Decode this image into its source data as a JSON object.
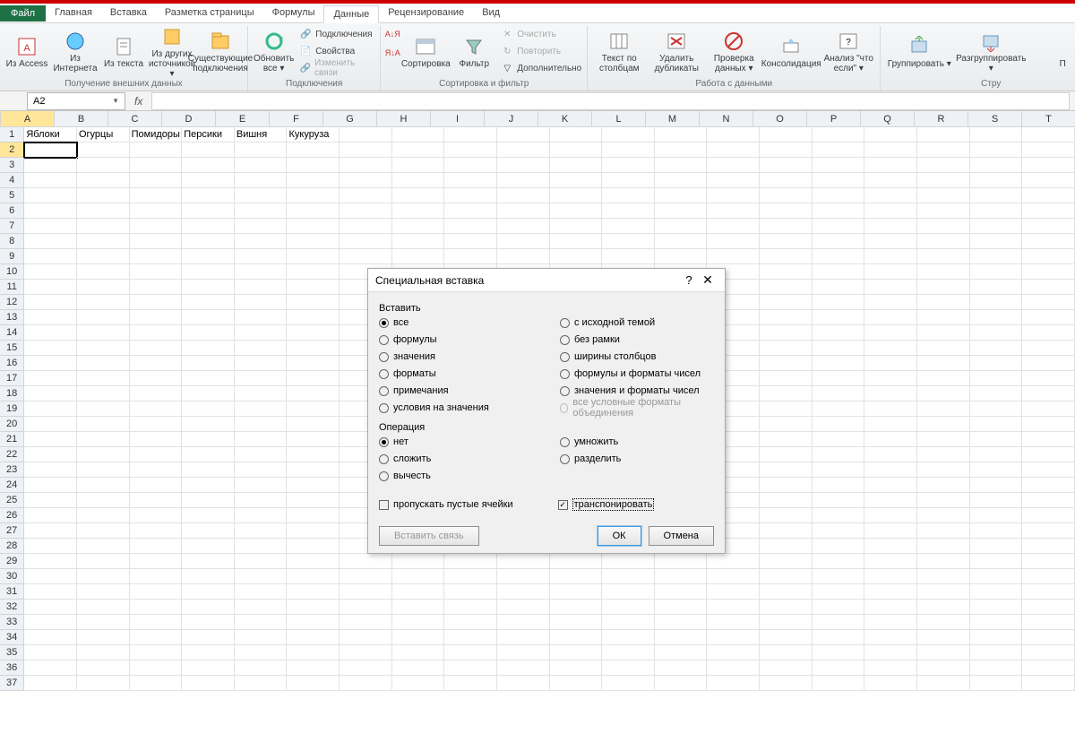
{
  "tabs": {
    "file": "Файл",
    "items": [
      "Главная",
      "Вставка",
      "Разметка страницы",
      "Формулы",
      "Данные",
      "Рецензирование",
      "Вид"
    ],
    "active": "Данные"
  },
  "ribbon": {
    "groups": [
      {
        "label": "Получение внешних данных",
        "buttons": [
          "Из Access",
          "Из Интернета",
          "Из текста",
          "Из других источников ▾",
          "Существующие подключения"
        ]
      },
      {
        "label": "Подключения",
        "big": "Обновить все ▾",
        "small": [
          "Подключения",
          "Свойства",
          "Изменить связи"
        ]
      },
      {
        "label": "Сортировка и фильтр",
        "big": [
          "",
          "Сортировка",
          "Фильтр"
        ],
        "small": [
          "Очистить",
          "Повторить",
          "Дополнительно"
        ]
      },
      {
        "label": "Работа с данными",
        "buttons": [
          "Текст по столбцам",
          "Удалить дубликаты",
          "Проверка данных ▾",
          "Консолидация",
          "Анализ \"что если\" ▾"
        ]
      },
      {
        "label": "Стру",
        "buttons": [
          "Группировать ▾",
          "Разгруппировать ▾",
          "П"
        ]
      }
    ],
    "sort_asc": "А↓Я",
    "sort_desc": "Я↓А"
  },
  "namebox": "A2",
  "columns": [
    "A",
    "B",
    "C",
    "D",
    "E",
    "F",
    "G",
    "H",
    "I",
    "J",
    "K",
    "L",
    "M",
    "N",
    "O",
    "P",
    "Q",
    "R",
    "S",
    "T"
  ],
  "row_data": {
    "1": [
      "Яблоки",
      "Огурцы",
      "Помидоры",
      "Персики",
      "Вишня",
      "Кукуруза",
      "",
      "",
      "",
      "",
      "",
      "",
      "",
      "",
      "",
      "",
      "",
      "",
      "",
      ""
    ]
  },
  "active_cell": {
    "row": 2,
    "col": 0
  },
  "num_rows": 37,
  "dialog": {
    "title": "Специальная вставка",
    "section_paste": "Вставить",
    "paste_left": [
      {
        "label": "все",
        "checked": true
      },
      {
        "label": "формулы",
        "checked": false
      },
      {
        "label": "значения",
        "checked": false
      },
      {
        "label": "форматы",
        "checked": false
      },
      {
        "label": "примечания",
        "checked": false
      },
      {
        "label": "условия на значения",
        "checked": false
      }
    ],
    "paste_right": [
      {
        "label": "с исходной темой",
        "checked": false
      },
      {
        "label": "без рамки",
        "checked": false
      },
      {
        "label": "ширины столбцов",
        "checked": false
      },
      {
        "label": "формулы и форматы чисел",
        "checked": false
      },
      {
        "label": "значения и форматы чисел",
        "checked": false
      },
      {
        "label": "все условные форматы объединения",
        "checked": false,
        "disabled": true
      }
    ],
    "section_op": "Операция",
    "op_left": [
      {
        "label": "нет",
        "checked": true
      },
      {
        "label": "сложить",
        "checked": false
      },
      {
        "label": "вычесть",
        "checked": false
      }
    ],
    "op_right": [
      {
        "label": "умножить",
        "checked": false
      },
      {
        "label": "разделить",
        "checked": false
      }
    ],
    "skip_blanks": {
      "label": "пропускать пустые ячейки",
      "checked": false
    },
    "transpose": {
      "label": "транспонировать",
      "checked": true
    },
    "paste_link": "Вставить связь",
    "ok": "ОК",
    "cancel": "Отмена"
  }
}
